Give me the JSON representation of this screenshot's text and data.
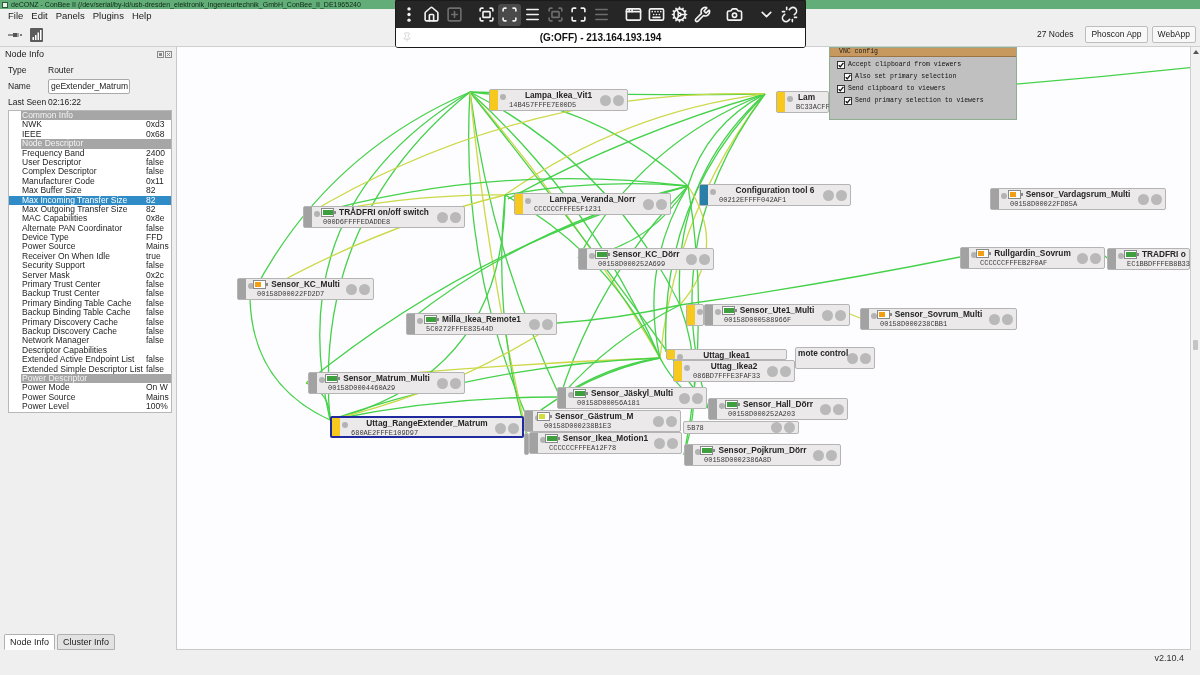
{
  "window": {
    "title": "deCONZ - ConBee II (/dev/serial/by-id/usb-dresden_elektronik_ingenieurtechnik_GmbH_ConBee_II_DE1965240"
  },
  "menu": [
    "File",
    "Edit",
    "Panels",
    "Plugins",
    "Help"
  ],
  "toolbar": {
    "node_count": "27 Nodes",
    "buttons": [
      "Phoscon App",
      "WebApp"
    ]
  },
  "node_info": {
    "title": "Node Info",
    "type_label": "Type",
    "type": "Router",
    "name_label": "Name",
    "name": "geExtender_Matrum",
    "last_seen_label": "Last Seen",
    "last_seen": "02:16:22",
    "table": [
      {
        "kind": "group",
        "label": "Common Info"
      },
      {
        "kind": "row",
        "label": "NWK",
        "value": "0xd3",
        "selected": false
      },
      {
        "kind": "row",
        "label": "IEEE",
        "value": "0x68",
        "selected": false
      },
      {
        "kind": "group",
        "label": "Node Descriptor"
      },
      {
        "kind": "row",
        "label": "Frequency Band",
        "value": "2400",
        "selected": false
      },
      {
        "kind": "row",
        "label": "User Descriptor",
        "value": "false",
        "selected": false
      },
      {
        "kind": "row",
        "label": "Complex Descriptor",
        "value": "false",
        "selected": false
      },
      {
        "kind": "row",
        "label": "Manufacturer Code",
        "value": "0x11",
        "selected": false
      },
      {
        "kind": "row",
        "label": "Max Buffer Size",
        "value": "82",
        "selected": false
      },
      {
        "kind": "row",
        "label": "Max Incoming Transfer Size",
        "value": "82",
        "selected": true
      },
      {
        "kind": "row",
        "label": "Max Outgoing Transfer Size",
        "value": "82",
        "selected": false
      },
      {
        "kind": "row",
        "label": "MAC Capabilities",
        "value": "0x8e",
        "selected": false
      },
      {
        "kind": "row",
        "label": "Alternate PAN Coordinator",
        "value": "false",
        "selected": false
      },
      {
        "kind": "row",
        "label": "Device Type",
        "value": "FFD",
        "selected": false
      },
      {
        "kind": "row",
        "label": "Power Source",
        "value": "Mains",
        "selected": false
      },
      {
        "kind": "row",
        "label": "Receiver On When Idle",
        "value": "true",
        "selected": false
      },
      {
        "kind": "row",
        "label": "Security Support",
        "value": "false",
        "selected": false
      },
      {
        "kind": "row",
        "label": "Server Mask",
        "value": "0x2c",
        "selected": false
      },
      {
        "kind": "row",
        "label": "Primary Trust Center",
        "value": "false",
        "selected": false
      },
      {
        "kind": "row",
        "label": "Backup Trust Center",
        "value": "false",
        "selected": false
      },
      {
        "kind": "row",
        "label": "Primary Binding Table Cache",
        "value": "false",
        "selected": false
      },
      {
        "kind": "row",
        "label": "Backup Binding Table Cache",
        "value": "false",
        "selected": false
      },
      {
        "kind": "row",
        "label": "Primary Discovery Cache",
        "value": "false",
        "selected": false
      },
      {
        "kind": "row",
        "label": "Backup Discovery Cache",
        "value": "false",
        "selected": false
      },
      {
        "kind": "row",
        "label": "Network Manager",
        "value": "false",
        "selected": false
      },
      {
        "kind": "row",
        "label": "Descriptor Capabilities",
        "selected": false
      },
      {
        "kind": "row",
        "label": "Extended Active Endpoint List",
        "value": "false",
        "selected": false
      },
      {
        "kind": "row",
        "label": "Extended Simple Descriptor List",
        "value": "false",
        "selected": false
      },
      {
        "kind": "group",
        "label": "Power Descriptor"
      },
      {
        "kind": "row",
        "label": "Power Mode",
        "value": "On W",
        "selected": false
      },
      {
        "kind": "row",
        "label": "Power Source",
        "value": "Mains",
        "selected": false
      },
      {
        "kind": "row",
        "label": "Power Level",
        "value": "100%",
        "selected": false
      }
    ]
  },
  "panel_tabs": [
    {
      "label": "Node Info",
      "selected": true
    },
    {
      "label": "Cluster Info",
      "selected": false
    }
  ],
  "nodes": [
    {
      "name": "Lampa_Ikea_Vit1",
      "mac": "14B457FFFE7E00D5",
      "kind": "router",
      "selected": false
    },
    {
      "name": "Lam",
      "mac": "BC33ACFF",
      "kind": "router",
      "selected": false
    },
    {
      "name": "Configuration tool 6",
      "mac": "00212EFFFF042AF1",
      "kind": "coordinator",
      "selected": false
    },
    {
      "name": "Lampa_Veranda_Norr",
      "mac": "CCCCCCFFFE5F1231",
      "kind": "router",
      "selected": false
    },
    {
      "name": "TRÅDFRI on/off switch",
      "mac": "000D6FFFFEDADDE8",
      "kind": "end_device",
      "battery": {
        "color": "#3e9f3e",
        "low": false
      },
      "selected": false
    },
    {
      "name": "Sensor_KC_Dörr",
      "mac": "00158D000252A699",
      "kind": "end_device",
      "battery": {
        "color": "#3e9f3e",
        "low": false
      },
      "selected": false
    },
    {
      "name": "Sensor_Vardagsrum_Multi",
      "mac": "00158D00022FD85A",
      "kind": "end_device",
      "battery": {
        "color": "#f2a012",
        "low": true
      },
      "selected": false
    },
    {
      "name": "Rullgardin_Sovrum",
      "mac": "CCCCCCFFFEB2F0AF",
      "kind": "end_device",
      "battery": {
        "color": "#f2a012",
        "low": true
      },
      "selected": false
    },
    {
      "name": "TRADFRI o",
      "mac": "EC1BBDFFFEB8B33",
      "kind": "end_device",
      "battery": {
        "color": "#3e9f3e",
        "low": false
      },
      "selected": false
    },
    {
      "name": "Sensor_KC_Multi",
      "mac": "00158D00022FD2D7",
      "kind": "end_device",
      "battery": {
        "color": "#f2a012",
        "low": true
      },
      "selected": false
    },
    {
      "kind": "router",
      "selected": false
    },
    {
      "name": "Sensor_Ute1_Multi",
      "mac": "00158D000588966F",
      "kind": "end_device",
      "battery": {
        "color": "#3e9f3e",
        "low": false
      },
      "selected": false
    },
    {
      "name": "Milla_Ikea_Remote1",
      "mac": "5C0272FFFE83544D",
      "kind": "end_device",
      "battery": {
        "color": "#3e9f3e",
        "low": false
      },
      "selected": false
    },
    {
      "name": "Sensor_Sovrum_Multi",
      "mac": "00158D000238CBB1",
      "kind": "end_device",
      "battery": {
        "color": "#f2a012",
        "low": true
      },
      "selected": false
    },
    {
      "name": "mote control",
      "selected": false
    },
    {
      "name": "Uttag_Ikea1",
      "kind": "router",
      "selected": false
    },
    {
      "name": "Uttag_Ikea2",
      "mac": "086BD7FFFE3FAF33",
      "kind": "router",
      "selected": false
    },
    {
      "name": "Sensor_Matrum_Multi",
      "mac": "00158D0004460A29",
      "kind": "end_device",
      "battery": {
        "color": "#3e9f3e",
        "low": false
      },
      "selected": false
    },
    {
      "mac": "5B78",
      "selected": false
    },
    {
      "name": "Sensor_Jäskyl_Multi",
      "mac": "00158D00056A181",
      "kind": "end_device",
      "battery": {
        "color": "#3e9f3e",
        "low": false
      },
      "selected": false
    },
    {
      "name": "Sensor_Gästrum_M",
      "mac": "00158D000238B1E3",
      "kind": "end_device",
      "battery": {
        "color": "#d2de3c",
        "low": true
      },
      "selected": false
    },
    {
      "name": "Sensor_Hall_Dörr",
      "mac": "00158D000252A203",
      "kind": "end_device",
      "battery": {
        "color": "#3e9f3e",
        "low": false
      },
      "selected": false
    },
    {
      "name": "Uttag_RangeExtender_Matrum",
      "mac": "680AE2FFFE109D97",
      "kind": "router",
      "selected": true
    },
    {
      "kind": "end_device",
      "selected": false
    },
    {
      "name": "Sensor_Ikea_Motion1",
      "mac": "CCCCCCFFFEA12F78",
      "kind": "end_device",
      "battery": {
        "color": "#3e9f3e",
        "low": false
      },
      "selected": false
    },
    {
      "name": "Sensor_Pojkrum_Dörr",
      "mac": "00158D0002386A8D",
      "kind": "end_device",
      "battery": {
        "color": "#3e9f3e",
        "low": false
      },
      "selected": false
    }
  ],
  "vnc_toolbar": {
    "buttons": [
      {
        "disabled": false,
        "selected": false
      },
      {
        "disabled": false,
        "selected": false
      },
      {
        "disabled": true,
        "selected": false
      },
      {
        "disabled": false,
        "selected": false
      },
      {
        "disabled": false,
        "selected": true
      },
      {
        "disabled": false,
        "selected": false
      },
      {
        "disabled": true,
        "selected": false
      },
      {
        "disabled": false,
        "selected": false
      },
      {
        "disabled": true,
        "selected": false
      },
      {
        "disabled": false,
        "selected": false
      },
      {
        "disabled": false,
        "selected": false
      },
      {
        "disabled": false,
        "selected": false
      },
      {
        "disabled": false,
        "selected": false
      },
      {
        "disabled": false,
        "selected": false
      },
      {
        "disabled": false,
        "selected": false
      },
      {
        "disabled": false,
        "selected": false
      }
    ],
    "status": "(G:OFF) - 213.164.193.194"
  },
  "vnc_config": {
    "title": "VNC config",
    "options": [
      {
        "label": "Accept clipboard from viewers",
        "checked": true,
        "children": [
          {
            "label": "Also set primary selection",
            "checked": true
          }
        ]
      },
      {
        "label": "Send clipboard to viewers",
        "checked": true,
        "children": [
          {
            "label": "Send primary selection to viewers",
            "checked": true
          }
        ]
      }
    ]
  },
  "status_bar": {
    "version": "v2.10.4"
  }
}
